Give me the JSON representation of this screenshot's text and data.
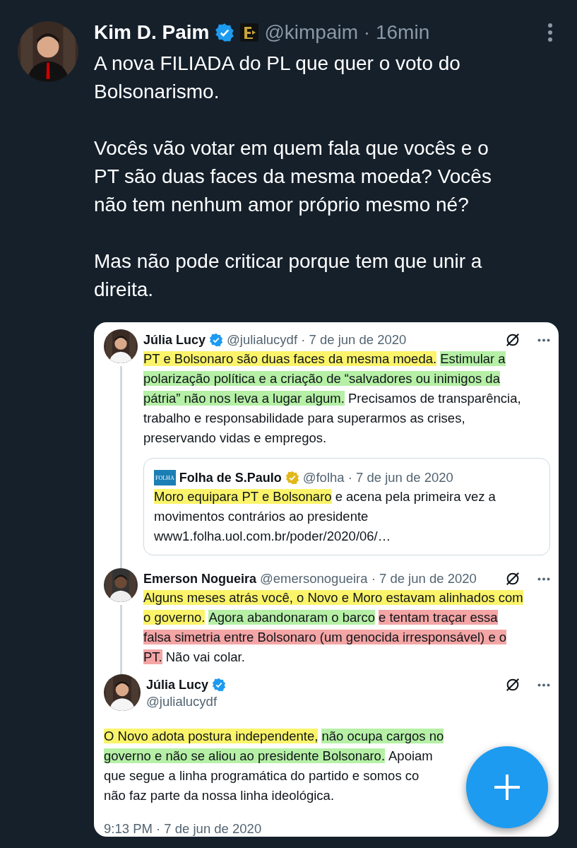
{
  "post": {
    "name": "Kim D. Paim",
    "handle": "@kimpaim",
    "time": "· 16min",
    "paragraphs": [
      [
        "A nova FILIADA do PL que quer o voto do",
        "Bolsonarismo."
      ],
      [
        "Vocês vão votar em quem fala que vocês e o",
        "PT são duas faces da mesma moeda? Vocês",
        "não tem nenhum amor próprio mesmo né?"
      ],
      [
        "Mas não pode criticar porque tem que unir a",
        "direita."
      ]
    ]
  },
  "screenshot": {
    "posts": [
      {
        "kind": "reply",
        "name": "Júlia Lucy",
        "badge": {
          "color": "#1d9bf0"
        },
        "handle": "@julialucydf",
        "time": "· 7 de jun de 2020",
        "lines": [
          [
            {
              "text": "PT e Bolsonaro são duas faces da mesma moeda.",
              "color": "#fbf46a"
            },
            {
              "text": "Estimular a",
              "color": "#b6f0a6"
            }
          ],
          [
            {
              "text": "polarização política e a criação de “salvadores ou inimigos da",
              "color": "#b6f0a6"
            }
          ],
          [
            {
              "text": "pátria” não nos leva a lugar algum.",
              "color": "#b6f0a6"
            },
            {
              "text": "Precisamos de transparência,"
            }
          ],
          [
            {
              "text": "trabalho e responsabilidade para superarmos as crises,"
            }
          ],
          [
            {
              "text": "preservando vidas e empregos."
            }
          ]
        ],
        "quote": {
          "logo": "FOLHA",
          "name": "Folha de S.Paulo",
          "badge": {
            "color": "#e2b719"
          },
          "handle": "@folha",
          "time": "· 7 de jun de 2020",
          "lines": [
            [
              {
                "text": "Moro equipara PT e Bolsonaro",
                "color": "#fbf46a"
              },
              {
                "text": "e acena pela primeira vez a"
              }
            ],
            [
              {
                "text": "movimentos contrários ao presidente"
              }
            ],
            [
              {
                "text": "www1.folha.uol.com.br/poder/2020/06/…"
              }
            ]
          ]
        }
      },
      {
        "kind": "reply",
        "name": "Emerson Nogueira",
        "handle": "@emersonogueira",
        "time": "· 7 de jun de 2020",
        "lines": [
          [
            {
              "text": "Alguns meses atrás você, o Novo e Moro estavam alinhados com",
              "color": "#fbf46a"
            }
          ],
          [
            {
              "text": "o governo.",
              "color": "#fbf46a"
            },
            {
              "text": "Agora abandonaram o barco",
              "color": "#b6f0a6"
            },
            {
              "text": "e tentam traçar essa",
              "color": "#f4a5a5"
            }
          ],
          [
            {
              "text": "falsa simetria entre Bolsonaro (um genocida irresponsável) e o",
              "color": "#f4a5a5"
            }
          ],
          [
            {
              "text": "PT.",
              "color": "#f4a5a5"
            },
            {
              "text": "Não vai colar."
            }
          ]
        ]
      },
      {
        "kind": "focal",
        "name": "Júlia Lucy",
        "badge": {
          "color": "#1d9bf0"
        },
        "handle": "@julialucydf",
        "lines": [
          [
            {
              "text": "O Novo adota postura independente,",
              "color": "#fbf46a"
            },
            {
              "text": "não ocupa cargos no",
              "color": "#b6f0a6"
            }
          ],
          [
            {
              "text": "governo e não se aliou ao presidente Bolsonaro.",
              "color": "#b6f0a6"
            },
            {
              "text": "Apoiam"
            }
          ],
          [
            {
              "text": "que segue a linha programática do partido e somos co"
            }
          ],
          [
            {
              "text": "não faz parte da nossa linha ideológica."
            }
          ]
        ],
        "timestamp": "9:13 PM · 7 de jun de 2020"
      }
    ]
  }
}
